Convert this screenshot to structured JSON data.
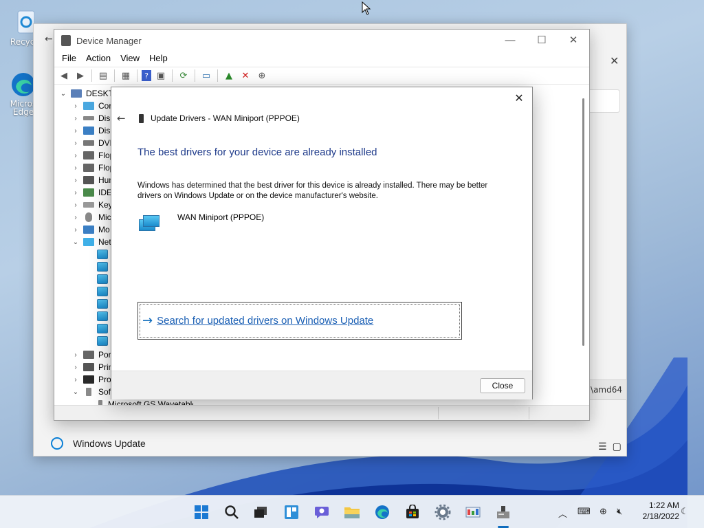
{
  "desktop": {
    "icons": [
      {
        "label": "Recycle",
        "icon": "recycle-bin-icon"
      },
      {
        "label": "Micros",
        "label2": "Edge",
        "icon": "edge-icon"
      }
    ]
  },
  "settings": {
    "path_text": "..\\amd64",
    "nav_item": "Windows Update",
    "nav_icon": "refresh-icon"
  },
  "device_manager": {
    "title": "Device Manager",
    "menu": [
      "File",
      "Action",
      "View",
      "Help"
    ],
    "tree": {
      "root": "DESKTO",
      "items": [
        {
          "label": "Cor",
          "expanded": false
        },
        {
          "label": "Disk",
          "expanded": false
        },
        {
          "label": "Disp",
          "expanded": false
        },
        {
          "label": "DVD",
          "expanded": false
        },
        {
          "label": "Flop",
          "expanded": false
        },
        {
          "label": "Flop",
          "expanded": false
        },
        {
          "label": "Hum",
          "expanded": false
        },
        {
          "label": "IDE",
          "expanded": false
        },
        {
          "label": "Key",
          "expanded": false
        },
        {
          "label": "Mic",
          "expanded": false
        },
        {
          "label": "Mo",
          "expanded": false
        },
        {
          "label": "Net",
          "expanded": true
        },
        {
          "label": "Por",
          "expanded": false
        },
        {
          "label": "Prin",
          "expanded": false
        },
        {
          "label": "Pro",
          "expanded": false
        },
        {
          "label": "Soft",
          "expanded": true
        }
      ],
      "child_last": "Microsoft GS Wavetable Synth"
    }
  },
  "dialog": {
    "header": "Update Drivers - WAN Miniport (PPPOE)",
    "heading": "The best drivers for your device are already installed",
    "description": "Windows has determined that the best driver for this device is already installed. There may be better drivers on Windows Update or on the device manufacturer's website.",
    "device_name": "WAN Miniport (PPPOE)",
    "link": "Search for updated drivers on Windows Update",
    "close_label": "Close"
  },
  "taskbar": {
    "time": "1:22 AM",
    "date": "2/18/2022"
  },
  "colors": {
    "accent": "#0f6cbd",
    "heading": "#1e3a8a"
  }
}
